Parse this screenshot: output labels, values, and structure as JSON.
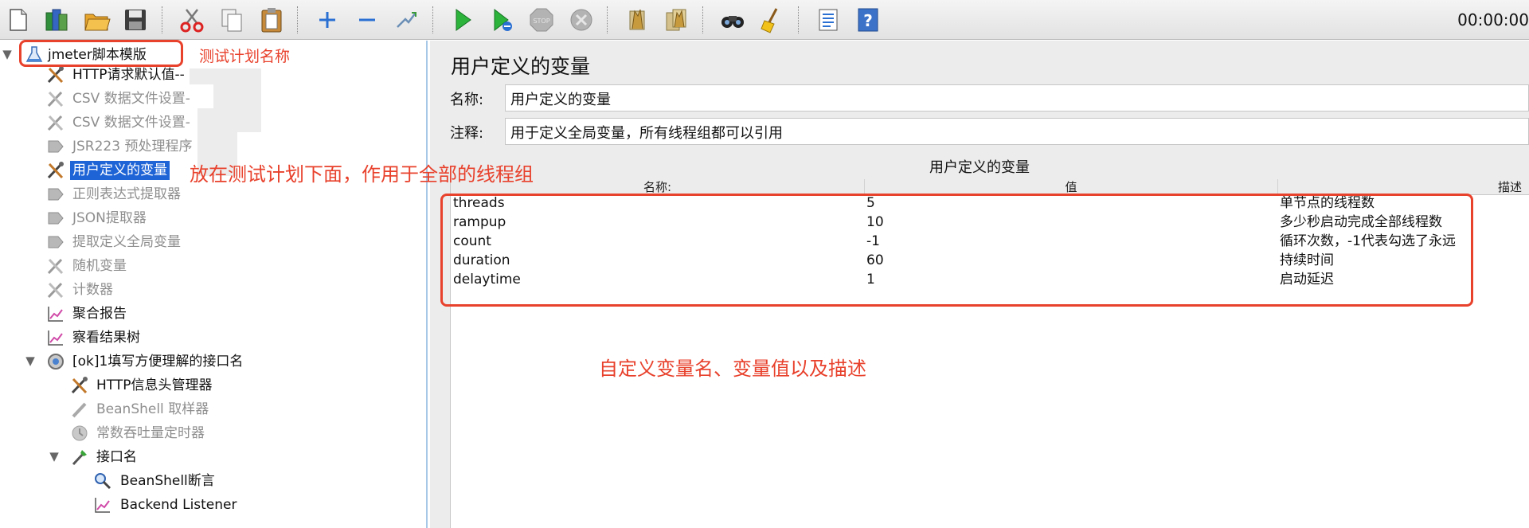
{
  "toolbar": {
    "timer": "00:00:00",
    "buttons": [
      "new-icon",
      "templates-icon",
      "open-icon",
      "save-icon",
      "cut-icon",
      "copy-icon",
      "paste-icon",
      "expand-icon",
      "collapse-icon",
      "toggle-icon",
      "start-icon",
      "start-no-pauses-icon",
      "stop-icon",
      "shutdown-icon",
      "clear-icon",
      "clear-all-icon",
      "search-icon",
      "reset-search-icon",
      "function-helper-icon",
      "help-icon"
    ]
  },
  "tree": {
    "items": [
      {
        "label": "jmeter脚本模版",
        "icon": "test-plan-icon",
        "state": "normal"
      },
      {
        "label": "HTTP请求默认值--",
        "icon": "config-element-icon",
        "state": "normal"
      },
      {
        "label": "CSV 数据文件设置-",
        "icon": "config-element-icon",
        "state": "disabled"
      },
      {
        "label": "CSV 数据文件设置-",
        "icon": "config-element-icon",
        "state": "disabled"
      },
      {
        "label": "JSR223 预处理程序",
        "icon": "preprocessor-icon",
        "state": "disabled"
      },
      {
        "label": "用户定义的变量",
        "icon": "config-element-icon",
        "state": "selected"
      },
      {
        "label": "正则表达式提取器",
        "icon": "postprocessor-icon",
        "state": "disabled"
      },
      {
        "label": "JSON提取器",
        "icon": "postprocessor-icon",
        "state": "disabled"
      },
      {
        "label": "提取定义全局变量",
        "icon": "postprocessor-icon",
        "state": "disabled"
      },
      {
        "label": "随机变量",
        "icon": "config-element-icon",
        "state": "disabled"
      },
      {
        "label": "计数器",
        "icon": "config-element-icon",
        "state": "disabled"
      },
      {
        "label": "聚合报告",
        "icon": "listener-graph-icon",
        "state": "normal"
      },
      {
        "label": "察看结果树",
        "icon": "listener-graph-icon",
        "state": "normal"
      },
      {
        "label": "[ok]1填写方便理解的接口名",
        "icon": "thread-group-icon",
        "state": "normal"
      },
      {
        "label": "HTTP信息头管理器",
        "icon": "config-element-icon",
        "state": "normal"
      },
      {
        "label": "BeanShell 取样器",
        "icon": "sampler-icon",
        "state": "disabled"
      },
      {
        "label": "常数吞吐量定时器",
        "icon": "timer-icon",
        "state": "disabled"
      },
      {
        "label": "接口名",
        "icon": "sampler-icon",
        "state": "normal"
      },
      {
        "label": "BeanShell断言",
        "icon": "assertion-icon",
        "state": "normal"
      },
      {
        "label": "Backend Listener",
        "icon": "listener-graph-icon",
        "state": "normal"
      }
    ]
  },
  "annotations": {
    "test_plan_name": "测试计划名称",
    "udv_scope": "放在测试计划下面，作用于全部的线程组",
    "table_note": "自定义变量名、变量值以及描述"
  },
  "panel": {
    "title": "用户定义的变量",
    "name_label": "名称:",
    "name_value": "用户定义的变量",
    "comment_label": "注释:",
    "comment_value": "用于定义全局变量，所有线程组都可以引用",
    "table_caption": "用户定义的变量",
    "columns": [
      "名称:",
      "值",
      "描述"
    ],
    "rows": [
      {
        "name": "threads",
        "value": "5",
        "desc": "单节点的线程数"
      },
      {
        "name": "rampup",
        "value": "10",
        "desc": "多少秒启动完成全部线程数"
      },
      {
        "name": "count",
        "value": "-1",
        "desc": "循环次数，-1代表勾选了永远"
      },
      {
        "name": "duration",
        "value": "60",
        "desc": "持续时间"
      },
      {
        "name": "delaytime",
        "value": "1",
        "desc": "启动延迟"
      }
    ]
  },
  "colors": {
    "annotation_red": "#e8412c",
    "selection_blue": "#1f64d6",
    "panel_bg": "#ececec"
  }
}
